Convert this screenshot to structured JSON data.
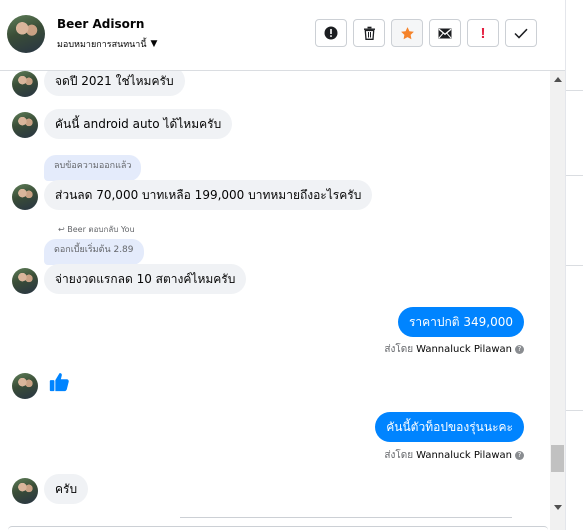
{
  "header": {
    "name": "Beer Adisorn",
    "assign_label": "มอบหมายการสนทนานี้",
    "tools": [
      "spam-icon",
      "trash-icon",
      "star-icon",
      "mail-icon",
      "important-icon",
      "check-icon"
    ]
  },
  "messages": {
    "m1": "จดปี 2021 ใช่ไหมครับ",
    "m2": "คันนี้ android auto ได้ไหมครับ",
    "m3_quote": "ลบข้อความออกแล้ว",
    "m3": "ส่วนลด 70,000 บาทเหลือ 199,000 บาทหมายถึงอะไรครับ",
    "m4_replied": "Beer ตอบกลับ You",
    "m4_quote": "ดอกเบี้ยเริ่มต้น 2.89",
    "m4": "จ่ายงวดแรกลด 10 สตางค์ไหมครับ",
    "out1": "ราคาปกติ   349,000",
    "sent1_prefix": "ส่งโดย",
    "sent1_name": "Wannaluck Pilawan",
    "out2": "คันนี้ตัวท็อปของรุ่นนะคะ",
    "sent2_prefix": "ส่งโดย",
    "sent2_name": "Wannaluck Pilawan",
    "m5": "ครับ"
  },
  "colors": {
    "outgoing": "#0084ff",
    "incoming": "#f0f2f5",
    "quote": "#e4ebfb",
    "star": "#f5832a",
    "important": "#e41e3f"
  }
}
